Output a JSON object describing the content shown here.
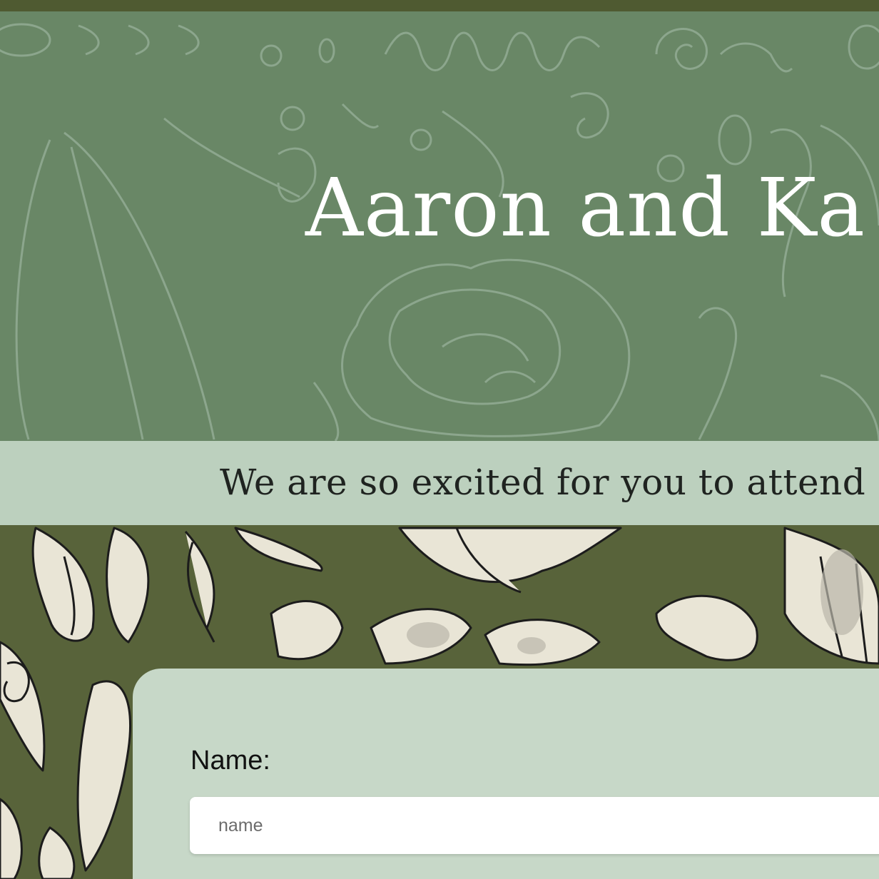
{
  "hero": {
    "title": "Aaron and Ka"
  },
  "banner": {
    "text": "We are so excited for you to attend ou"
  },
  "form": {
    "name_label": "Name:",
    "name_placeholder": "name",
    "name_value": ""
  },
  "colors": {
    "page_background": "#58633a",
    "hero_overlay": "#6e9173",
    "banner_overlay": "#cde2d4",
    "card": "#d6e8dc",
    "title_text": "#ffffff"
  }
}
